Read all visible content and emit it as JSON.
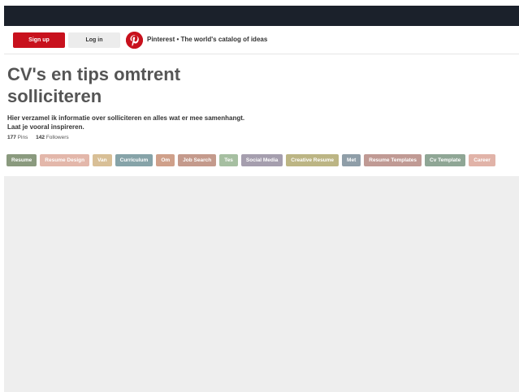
{
  "header": {
    "signup_label": "Sign up",
    "login_label": "Log in",
    "logo_icon": "pinterest-logo-icon",
    "tagline": "Pinterest • The world's catalog of ideas"
  },
  "board": {
    "title_line1": "CV's en tips omtrent",
    "title_line2": "solliciteren",
    "description": "Hier verzamel ik informatie over solliciteren en alles wat er mee samenhangt. Laat je vooral inspireren.",
    "pins_count": "177",
    "pins_label": "Pins",
    "followers_count": "142",
    "followers_label": "Followers"
  },
  "tags": [
    {
      "label": "Resume",
      "color": "#8a9a7e"
    },
    {
      "label": "Resume Design",
      "color": "#e3b7aa"
    },
    {
      "label": "Van",
      "color": "#d8bf96"
    },
    {
      "label": "Curriculum",
      "color": "#86a3a8"
    },
    {
      "label": "Om",
      "color": "#cfa08a"
    },
    {
      "label": "Job Search",
      "color": "#c49a8c"
    },
    {
      "label": "Tes",
      "color": "#a6bfa1"
    },
    {
      "label": "Social Media",
      "color": "#a59eae"
    },
    {
      "label": "Creative Resume",
      "color": "#bcb584"
    },
    {
      "label": "Met",
      "color": "#8f9ea8"
    },
    {
      "label": "Resume Templates",
      "color": "#c09a94"
    },
    {
      "label": "Cv Template",
      "color": "#8fa695"
    },
    {
      "label": "Career",
      "color": "#e1b3a8"
    }
  ],
  "colors": {
    "topbar": "#1b212b",
    "brand_red": "#c8111d",
    "pin_area": "#eeeeee"
  }
}
